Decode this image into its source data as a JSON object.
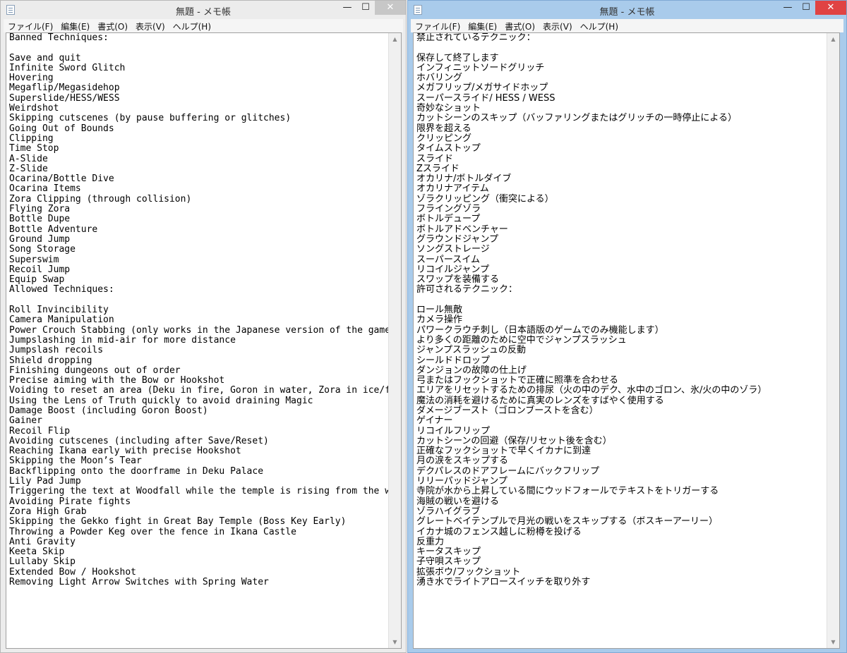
{
  "left_window": {
    "title": "無題 - メモ帳",
    "controls": {
      "minimize": "—",
      "maximize": "☐",
      "close": "✕"
    },
    "menu": [
      "ファイル(F)",
      "編集(E)",
      "書式(O)",
      "表示(V)",
      "ヘルプ(H)"
    ],
    "lines": [
      "Banned Techniques:",
      "",
      "Save and quit",
      "Infinite Sword Glitch",
      "Hovering",
      "Megaflip/Megasidehop",
      "Superslide/HESS/WESS",
      "Weirdshot",
      "Skipping cutscenes (by pause buffering or glitches)",
      "Going Out of Bounds",
      "Clipping",
      "Time Stop",
      "A-Slide",
      "Z-Slide",
      "Ocarina/Bottle Dive",
      "Ocarina Items",
      "Zora Clipping (through collision)",
      "Flying Zora",
      "Bottle Dupe",
      "Bottle Adventure",
      "Ground Jump",
      "Song Storage",
      "Superswim",
      "Recoil Jump",
      "Equip Swap",
      "Allowed Techniques:",
      "",
      "Roll Invincibility",
      "Camera Manipulation",
      "Power Crouch Stabbing (only works in the Japanese version of the game)",
      "Jumpslashing in mid-air for more distance",
      "Jumpslash recoils",
      "Shield dropping",
      "Finishing dungeons out of order",
      "Precise aiming with the Bow or Hookshot",
      "Voiding to reset an area (Deku in fire, Goron in water, Zora in ice/fire)",
      "Using the Lens of Truth quickly to avoid draining Magic",
      "Damage Boost (including Goron Boost)",
      "Gainer",
      "Recoil Flip",
      "Avoiding cutscenes (including after Save/Reset)",
      "Reaching Ikana early with precise Hookshot",
      "Skipping the Moon’s Tear",
      "Backflipping onto the doorframe in Deku Palace",
      "Lily Pad Jump",
      "Triggering the text at Woodfall while the temple is rising from the water",
      "Avoiding Pirate fights",
      "Zora High Grab",
      "Skipping the Gekko fight in Great Bay Temple (Boss Key Early)",
      "Throwing a Powder Keg over the fence in Ikana Castle",
      "Anti Gravity",
      "Keeta Skip",
      "Lullaby Skip",
      "Extended Bow / Hookshot",
      "Removing Light Arrow Switches with Spring Water"
    ]
  },
  "right_window": {
    "title": "無題 - メモ帳",
    "controls": {
      "minimize": "—",
      "maximize": "☐",
      "close": "✕"
    },
    "menu": [
      "ファイル(F)",
      "編集(E)",
      "書式(O)",
      "表示(V)",
      "ヘルプ(H)"
    ],
    "lines": [
      "禁止されているテクニック：",
      "",
      "保存して終了します",
      "インフィニットソードグリッチ",
      "ホバリング",
      "メガフリップ/メガサイドホップ",
      "スーパースライド/ HESS / WESS",
      "奇妙なショット",
      "カットシーンのスキップ（バッファリングまたはグリッチの一時停止による）",
      "限界を超える",
      "クリッピング",
      "タイムストップ",
      "スライド",
      "Zスライド",
      "オカリナ/ボトルダイブ",
      "オカリナアイテム",
      "ゾラクリッピング（衝突による）",
      "フライングゾラ",
      "ボトルデュープ",
      "ボトルアドベンチャー",
      "グラウンドジャンプ",
      "ソングストレージ",
      "スーパースイム",
      "リコイルジャンプ",
      "スワップを装備する",
      "許可されるテクニック：",
      "",
      "ロール無敵",
      "カメラ操作",
      "パワークラウチ刺し（日本語版のゲームでのみ機能します）",
      "より多くの距離のために空中でジャンプスラッシュ",
      "ジャンプスラッシュの反動",
      "シールドドロップ",
      "ダンジョンの故障の仕上げ",
      "弓またはフックショットで正確に照準を合わせる",
      "エリアをリセットするための排尿（火の中のデク、水中のゴロン、氷/火の中のゾラ）",
      "魔法の消耗を避けるために真実のレンズをすばやく使用する",
      "ダメージブースト（ゴロンブーストを含む）",
      "ゲイナー",
      "リコイルフリップ",
      "カットシーンの回避（保存/リセット後を含む）",
      "正確なフックショットで早くイカナに到達",
      "月の涙をスキップする",
      "デクパレスのドアフレームにバックフリップ",
      "リリーパッドジャンプ",
      "寺院が水から上昇している間にウッドフォールでテキストをトリガーする",
      "海賊の戦いを避ける",
      "ゾラハイグラブ",
      "グレートベイテンプルで月光の戦いをスキップする（ボスキーアーリー）",
      "イカナ城のフェンス越しに粉樽を投げる",
      "反重力",
      "キータスキップ",
      "子守唄スキップ",
      "拡張ボウ/フックショット",
      "湧き水でライトアロースイッチを取り外す"
    ]
  }
}
